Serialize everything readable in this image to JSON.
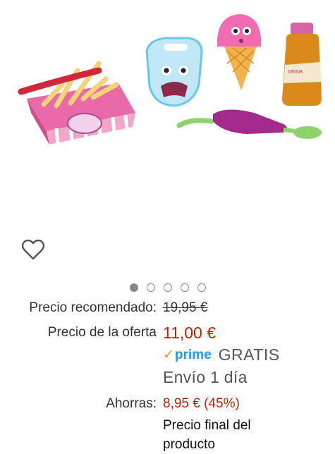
{
  "product": {
    "image_alt": "toy food set: fries box, bib, ice cream cone, drink bottle, spoon"
  },
  "wishlist": {
    "icon": "heart-outline-icon"
  },
  "carousel": {
    "count": 5,
    "active_index": 0
  },
  "pricing": {
    "recommended_label": "Precio recomendado:",
    "recommended_value": "19,95 €",
    "offer_label": "Precio de la oferta",
    "offer_value": "11,00 €",
    "prime_text": "prime",
    "free_text": "GRATIS",
    "shipping_text": "Envío 1 día",
    "savings_label": "Ahorras:",
    "savings_value": "8,95 € (45%)",
    "final_line1": "Precio final del",
    "final_line2": "producto"
  },
  "colors": {
    "price_red": "#B12704",
    "prime_blue": "#1a98ff",
    "prime_check": "#ff9900"
  }
}
